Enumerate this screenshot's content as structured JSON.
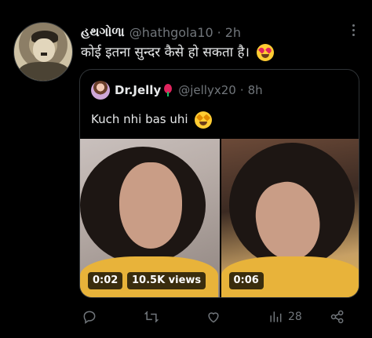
{
  "tweet": {
    "display_name": "હથગોળા",
    "handle": "@hathgola10",
    "separator": "·",
    "time": "2h",
    "text": "कोई इतना सुन्दर कैसे हो सकता है।",
    "emoji": "heart-eyes-emoji"
  },
  "quoted": {
    "display_name": "Dr.Jelly",
    "handle": "@jellyx20",
    "separator": "·",
    "time": "8h",
    "text": "Kuch nhi bas uhi",
    "emoji": "star-struck-emoji",
    "videos": [
      {
        "duration": "0:02",
        "views": "10.5K views"
      },
      {
        "duration": "0:06"
      }
    ]
  },
  "actions": {
    "reply_icon": "reply-icon",
    "retweet_icon": "retweet-icon",
    "like_icon": "like-icon",
    "views_icon": "views-icon",
    "views_count": "28",
    "share_icon": "share-icon"
  },
  "colors": {
    "background": "#000000",
    "text": "#e7e9ea",
    "muted": "#71767b",
    "border": "#2f3336"
  }
}
